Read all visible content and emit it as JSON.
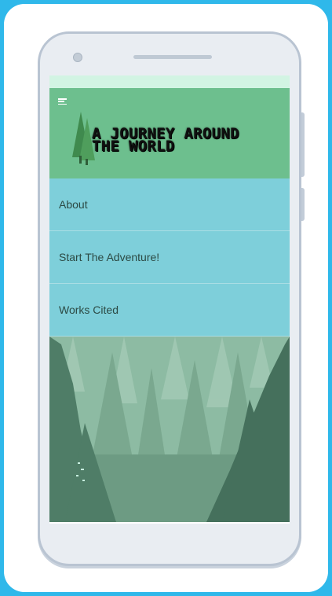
{
  "logo": {
    "title": "A JOURNEY AROUND\nTHE WORLD",
    "icon": "tree-icon"
  },
  "menu": {
    "icon": "hamburger-menu-icon",
    "items": [
      {
        "label": "About"
      },
      {
        "label": "Start The Adventure!"
      },
      {
        "label": "Works Cited"
      }
    ]
  },
  "hero": {
    "image": "misty-forest-illustration"
  },
  "colors": {
    "background": "#2fb8ea",
    "status_bar": "#d2f4e3",
    "header": "#6dbf8e",
    "nav": "#7ecfda",
    "forest": "#6b9a82"
  }
}
